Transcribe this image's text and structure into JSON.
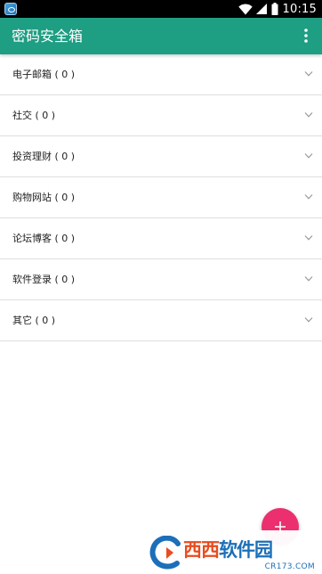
{
  "status_bar": {
    "time": "10:15",
    "icons": [
      "app-notification-icon",
      "wifi-icon",
      "signal-icon",
      "battery-icon"
    ]
  },
  "app_bar": {
    "title": "密码安全箱",
    "menu_icon": "overflow-menu-icon",
    "color": "#1e9e83"
  },
  "categories": [
    {
      "label": "电子邮箱 ( 0 )"
    },
    {
      "label": "社交 ( 0 )"
    },
    {
      "label": "投资理财 ( 0 )"
    },
    {
      "label": "购物网站 ( 0 )"
    },
    {
      "label": "论坛博客 ( 0 )"
    },
    {
      "label": "软件登录 ( 0 )"
    },
    {
      "label": "其它 ( 0 )"
    }
  ],
  "fab": {
    "icon": "plus-icon",
    "color": "#ec2f6e"
  },
  "watermark": {
    "text_a": "西西",
    "text_b": "软件园",
    "url": "CR173.COM"
  }
}
